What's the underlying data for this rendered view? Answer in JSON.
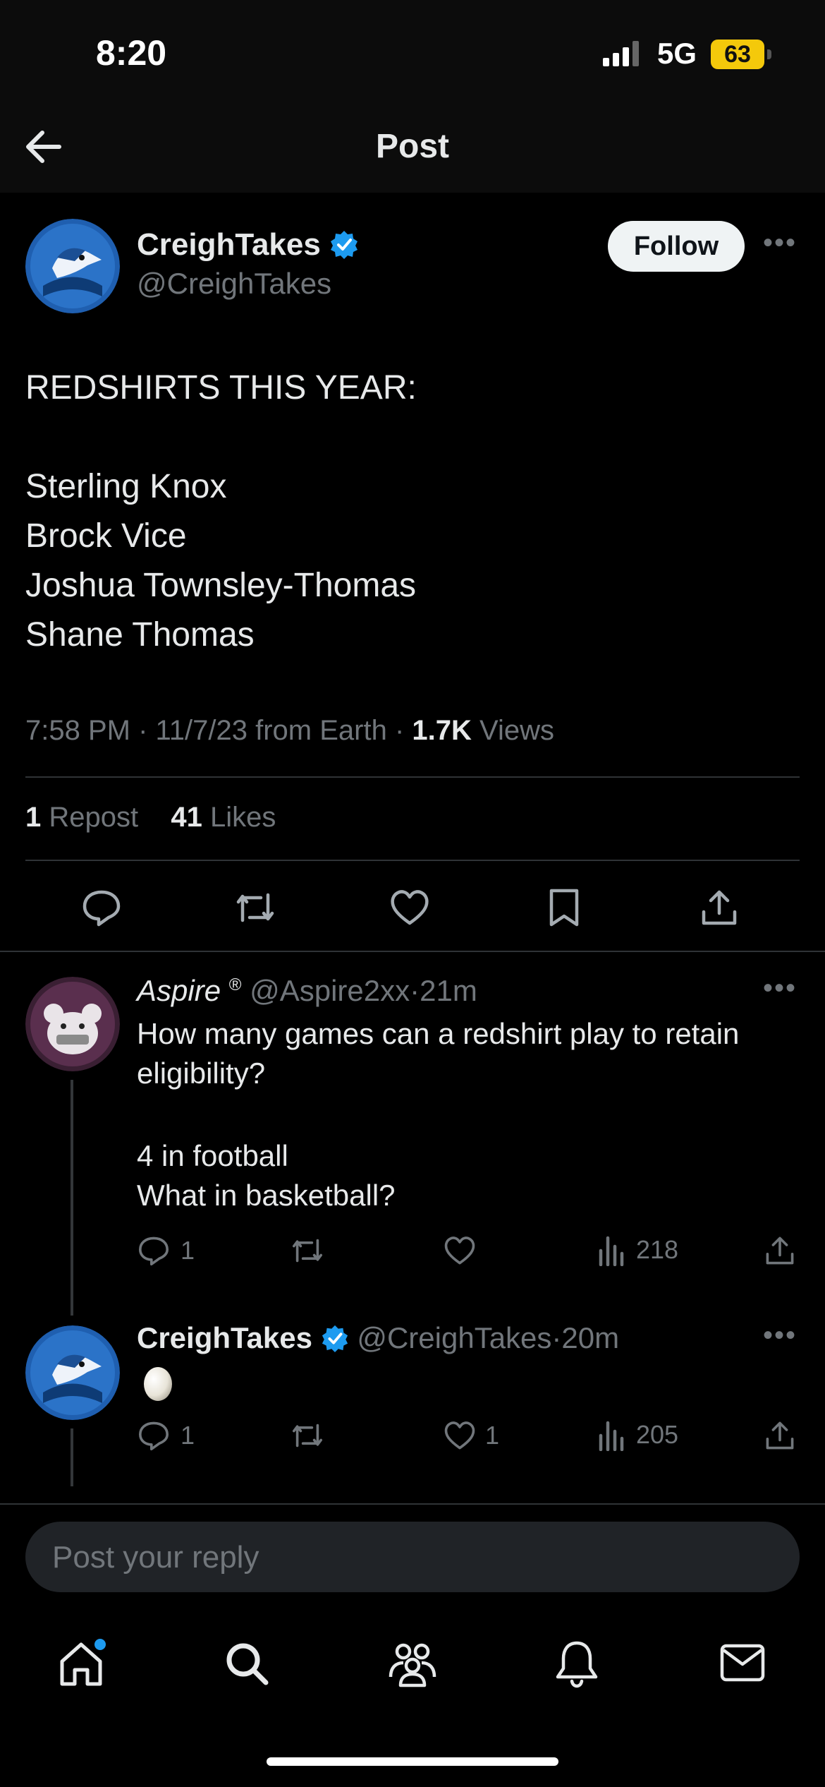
{
  "status_bar": {
    "time": "8:20",
    "network": "5G",
    "battery": "63"
  },
  "header": {
    "title": "Post"
  },
  "post": {
    "author_name": "CreighTakes",
    "handle": "@CreighTakes",
    "follow_label": "Follow",
    "lines": [
      "REDSHIRTS THIS YEAR:",
      "",
      "Sterling Knox",
      "Brock Vice",
      "Joshua Townsley-Thomas",
      "Shane Thomas"
    ],
    "timestamp": "7:58 PM · 11/7/23 from Earth · ",
    "views_count": "1.7K",
    "views_label": " Views",
    "reposts_count": "1",
    "reposts_label": " Repost",
    "likes_count": "41",
    "likes_label": " Likes"
  },
  "replies": [
    {
      "author_name": "Aspire",
      "author_mark": "®",
      "handle": "@Aspire2xx",
      "time": "21m",
      "lines": [
        "How many games can a redshirt play to retain",
        "eligibility?",
        "",
        "4 in football",
        "What in basketball?"
      ],
      "reply_count": "1",
      "repost_count": "",
      "like_count": "",
      "view_count": "218"
    },
    {
      "author_name": "CreighTakes",
      "handle": "@CreighTakes",
      "time": "20m",
      "emoji": "egg",
      "reply_count": "1",
      "repost_count": "",
      "like_count": "1",
      "view_count": "205"
    }
  ],
  "compose": {
    "placeholder": "Post your reply"
  },
  "icons": {
    "back": "arrow-left-icon",
    "reply": "comment-icon",
    "repost": "repost-icon",
    "like": "heart-icon",
    "bookmark": "bookmark-icon",
    "share": "share-icon",
    "views": "views-icon",
    "verified": "verified-badge-icon"
  },
  "colors": {
    "accent": "#1d9bf0",
    "muted": "#71767b",
    "battery": "#f4c90b",
    "divider": "#2f3336"
  }
}
